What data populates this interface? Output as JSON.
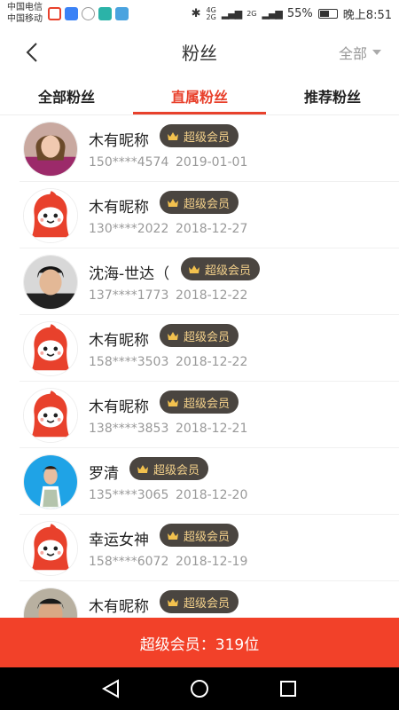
{
  "status_bar": {
    "carrier1": "中国电信",
    "carrier2": "中国移动",
    "network1": "4G",
    "network2": "2G",
    "network3": "2G",
    "battery": "55%",
    "battery_level": 0.55,
    "time": "晚上8:51"
  },
  "header": {
    "title": "粉丝",
    "filter": "全部"
  },
  "tabs": [
    {
      "label": "全部粉丝"
    },
    {
      "label": "直属粉丝"
    },
    {
      "label": "推荐粉丝"
    }
  ],
  "fans": [
    {
      "name": "木有昵称",
      "badge": "超级会员",
      "phone": "150****4574",
      "date": "2019-01-01",
      "avatar": "photo-woman"
    },
    {
      "name": "木有昵称",
      "badge": "超级会员",
      "phone": "130****2022",
      "date": "2018-12-27",
      "avatar": "default"
    },
    {
      "name": "沈海-世达（",
      "badge": "超级会员",
      "phone": "137****1773",
      "date": "2018-12-22",
      "avatar": "photo-man"
    },
    {
      "name": "木有昵称",
      "badge": "超级会员",
      "phone": "158****3503",
      "date": "2018-12-22",
      "avatar": "default"
    },
    {
      "name": "木有昵称",
      "badge": "超级会员",
      "phone": "138****3853",
      "date": "2018-12-21",
      "avatar": "default"
    },
    {
      "name": "罗清",
      "badge": "超级会员",
      "phone": "135****3065",
      "date": "2018-12-20",
      "avatar": "photo-woman-blue"
    },
    {
      "name": "幸运女神",
      "badge": "超级会员",
      "phone": "158****6072",
      "date": "2018-12-19",
      "avatar": "default"
    },
    {
      "name": "木有昵称",
      "badge": "超级会员",
      "phone": "",
      "date": "",
      "avatar": "photo-man2"
    }
  ],
  "footer": {
    "label": "超级会员：319位"
  },
  "colors": {
    "accent": "#e8412c",
    "footer_bg": "#f24129",
    "badge_bg": "#4a4540",
    "badge_text": "#f2d08a"
  }
}
